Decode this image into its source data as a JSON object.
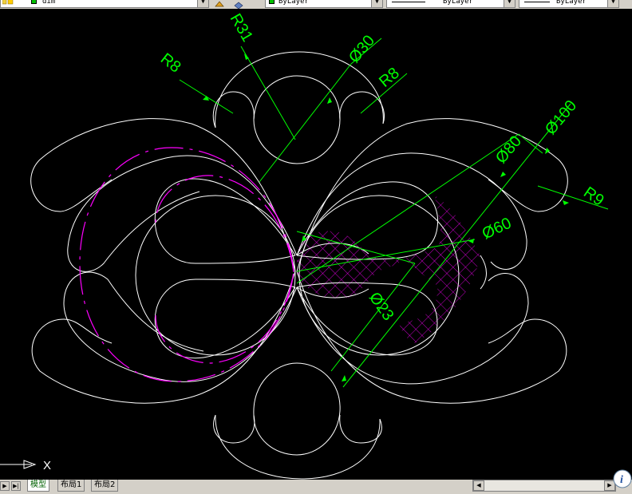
{
  "toolbar": {
    "layer_name": "dim",
    "color_value": "ByLayer",
    "linetype_value": "ByLayer",
    "lineweight_value": "ByLayer"
  },
  "drawing": {
    "dims": {
      "r31": "R31",
      "d30": "Ø30",
      "r8_left": "R8",
      "r8_right": "R8",
      "d80": "Ø80",
      "d100": "Ø100",
      "r9": "R9",
      "d60": "Ø60",
      "d23": "Ø23"
    },
    "ucs_axis": "X"
  },
  "tabs": {
    "model": "模型",
    "layout1": "布局1",
    "layout2": "布局2"
  },
  "colors": {
    "geometry": "#ffffff",
    "dimension": "#00ff00",
    "hatch": "#ff00ff",
    "background": "#000000"
  }
}
